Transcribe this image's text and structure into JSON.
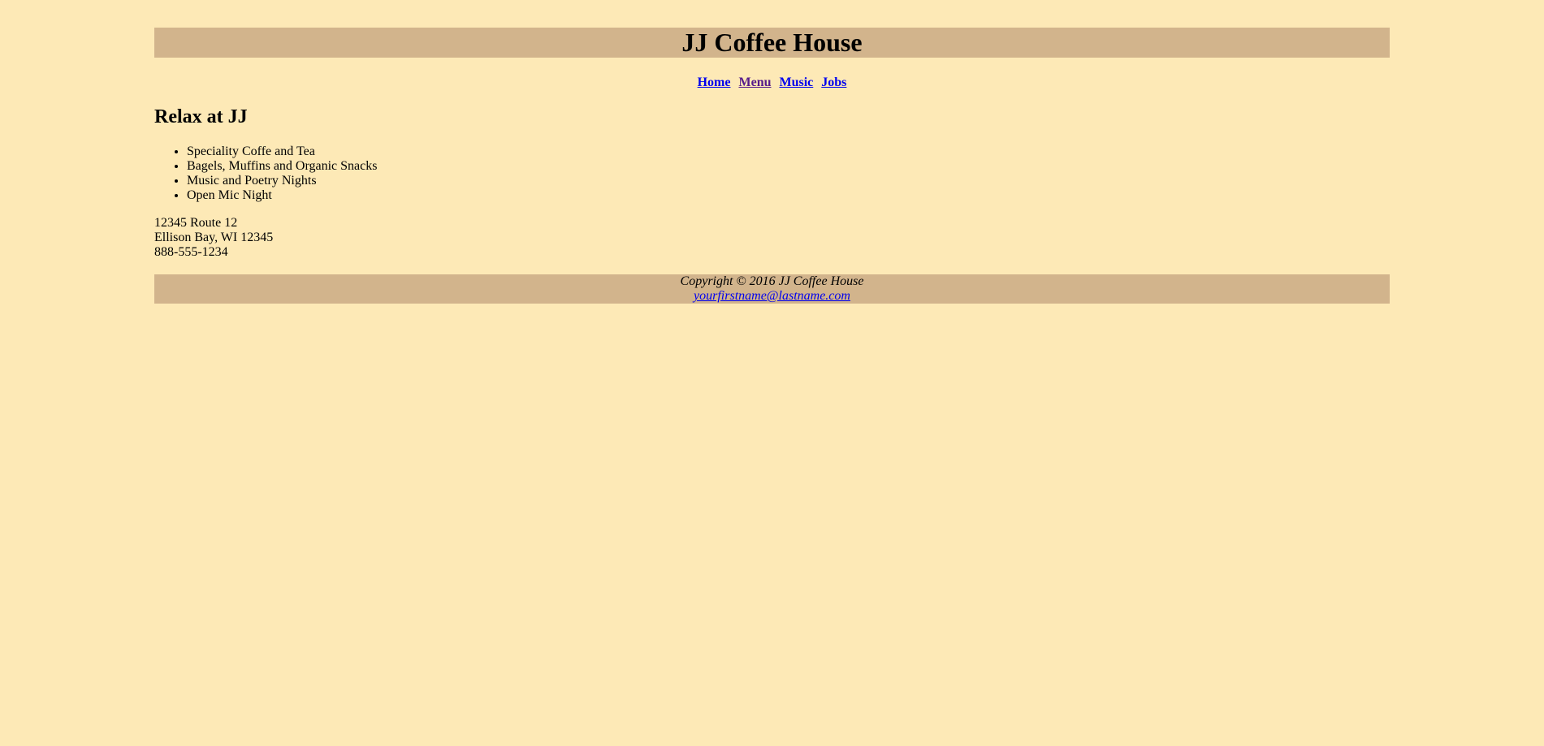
{
  "header": {
    "title": "JJ Coffee House"
  },
  "nav": {
    "items": [
      {
        "label": "Home"
      },
      {
        "label": "Menu"
      },
      {
        "label": "Music"
      },
      {
        "label": "Jobs"
      }
    ]
  },
  "main": {
    "heading": "Relax at JJ",
    "features": [
      "Speciality Coffe and Tea",
      "Bagels, Muffins and Organic Snacks",
      "Music and Poetry Nights",
      "Open Mic Night"
    ],
    "address": {
      "street": "12345 Route 12",
      "city": "Ellison Bay, WI 12345",
      "phone": "888-555-1234"
    }
  },
  "footer": {
    "copyright": "Copyright © 2016 JJ Coffee House",
    "email": "yourfirstname@lastname.com"
  },
  "colors": {
    "background": "#FDE9B6",
    "bar": "#D2B48C",
    "link": "#0000EE",
    "visited": "#551A8B"
  }
}
